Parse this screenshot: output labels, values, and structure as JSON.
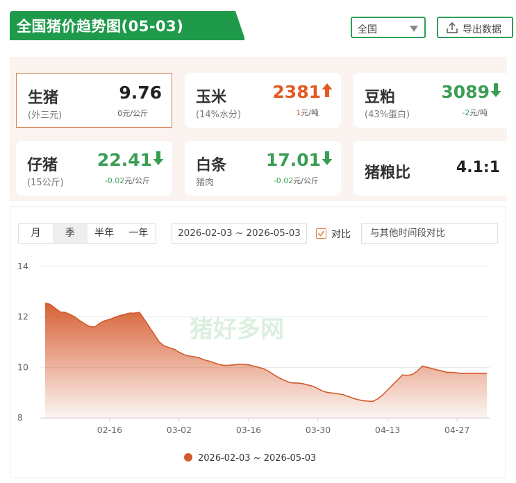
{
  "header": {
    "title": "全国猪价趋势图(05-03)",
    "region_select": "全国",
    "export_label": "导出数据"
  },
  "cards": [
    {
      "name": "生猪",
      "sub": "(外三元)",
      "price": "9.76",
      "trend": "flat",
      "change_num": "0",
      "change_unit": "元/公斤",
      "selected": true
    },
    {
      "name": "玉米",
      "sub": "(14%水分)",
      "price": "2381",
      "trend": "up",
      "change_num": "1",
      "change_unit": "元/吨",
      "selected": false
    },
    {
      "name": "豆粕",
      "sub": "(43%蛋白)",
      "price": "3089",
      "trend": "down",
      "change_num": "-2",
      "change_unit": "元/吨",
      "selected": false
    },
    {
      "name": "仔猪",
      "sub": "(15公斤)",
      "price": "22.41",
      "trend": "down",
      "change_num": "-0.02",
      "change_unit": "元/公斤",
      "selected": false
    },
    {
      "name": "白条",
      "sub": "猪肉",
      "price": "17.01",
      "trend": "down",
      "change_num": "-0.02",
      "change_unit": "元/公斤",
      "selected": false
    },
    {
      "name": "猪粮比",
      "sub": "",
      "price": "4.1:1",
      "trend": "none",
      "change_num": "",
      "change_unit": "",
      "selected": false
    }
  ],
  "controls": {
    "periods": [
      "月",
      "季",
      "半年",
      "一年"
    ],
    "active_period": "季",
    "date_range": "2026-02-03 ~ 2026-05-03",
    "compare_label": "对比",
    "compare_checked": true,
    "compare_placeholder": "与其他时间段对比"
  },
  "watermark": "猪好多网",
  "colors": {
    "brand_green": "#1f9a4a",
    "series": "#d4592b",
    "up": "#e25a22",
    "down": "#3a9e55"
  },
  "chart_data": {
    "type": "area",
    "title": "",
    "xlabel": "",
    "ylabel": "",
    "ylim": [
      8,
      14
    ],
    "yticks": [
      8,
      10,
      12,
      14
    ],
    "x_tick_labels": [
      "02-16",
      "03-02",
      "03-16",
      "03-30",
      "04-13",
      "04-27"
    ],
    "x_tick_dates": [
      "2026-02-16",
      "2026-03-02",
      "2026-03-16",
      "2026-03-30",
      "2026-04-13",
      "2026-04-27"
    ],
    "grid": true,
    "legend_position": "bottom",
    "series": [
      {
        "name": "2026-02-03 ~ 2026-05-03",
        "x": [
          "2026-02-03",
          "2026-02-04",
          "2026-02-05",
          "2026-02-06",
          "2026-02-07",
          "2026-02-08",
          "2026-02-09",
          "2026-02-10",
          "2026-02-11",
          "2026-02-12",
          "2026-02-13",
          "2026-02-14",
          "2026-02-15",
          "2026-02-16",
          "2026-02-17",
          "2026-02-18",
          "2026-02-19",
          "2026-02-20",
          "2026-02-21",
          "2026-02-22",
          "2026-02-23",
          "2026-02-24",
          "2026-02-25",
          "2026-02-26",
          "2026-02-27",
          "2026-02-28",
          "2026-03-01",
          "2026-03-02",
          "2026-03-03",
          "2026-03-04",
          "2026-03-05",
          "2026-03-06",
          "2026-03-07",
          "2026-03-08",
          "2026-03-09",
          "2026-03-10",
          "2026-03-11",
          "2026-03-12",
          "2026-03-13",
          "2026-03-14",
          "2026-03-15",
          "2026-03-16",
          "2026-03-17",
          "2026-03-18",
          "2026-03-19",
          "2026-03-20",
          "2026-03-21",
          "2026-03-22",
          "2026-03-23",
          "2026-03-24",
          "2026-03-25",
          "2026-03-26",
          "2026-03-27",
          "2026-03-28",
          "2026-03-29",
          "2026-03-30",
          "2026-03-31",
          "2026-04-01",
          "2026-04-02",
          "2026-04-03",
          "2026-04-04",
          "2026-04-05",
          "2026-04-06",
          "2026-04-07",
          "2026-04-08",
          "2026-04-09",
          "2026-04-10",
          "2026-04-11",
          "2026-04-12",
          "2026-04-13",
          "2026-04-14",
          "2026-04-15",
          "2026-04-16",
          "2026-04-17",
          "2026-04-18",
          "2026-04-19",
          "2026-04-20",
          "2026-04-21",
          "2026-04-22",
          "2026-04-23",
          "2026-04-24",
          "2026-04-25",
          "2026-04-26",
          "2026-04-27",
          "2026-04-28",
          "2026-04-29",
          "2026-04-30",
          "2026-05-01",
          "2026-05-02",
          "2026-05-03"
        ],
        "y": [
          12.55,
          12.5,
          12.35,
          12.2,
          12.18,
          12.1,
          12.0,
          11.85,
          11.72,
          11.62,
          11.6,
          11.75,
          11.85,
          11.9,
          11.98,
          12.05,
          12.1,
          12.15,
          12.15,
          12.18,
          11.9,
          11.6,
          11.3,
          11.0,
          10.85,
          10.78,
          10.72,
          10.6,
          10.5,
          10.45,
          10.42,
          10.38,
          10.3,
          10.25,
          10.18,
          10.12,
          10.08,
          10.08,
          10.1,
          10.12,
          10.12,
          10.1,
          10.05,
          10.0,
          9.95,
          9.85,
          9.72,
          9.6,
          9.5,
          9.42,
          9.38,
          9.38,
          9.35,
          9.3,
          9.25,
          9.15,
          9.05,
          9.0,
          8.98,
          8.95,
          8.92,
          8.85,
          8.78,
          8.72,
          8.68,
          8.66,
          8.65,
          8.75,
          8.9,
          9.1,
          9.3,
          9.5,
          9.7,
          9.68,
          9.72,
          9.85,
          10.05,
          10.0,
          9.95,
          9.9,
          9.85,
          9.8,
          9.8,
          9.78,
          9.76,
          9.76,
          9.76,
          9.76,
          9.76,
          9.76
        ]
      }
    ]
  }
}
